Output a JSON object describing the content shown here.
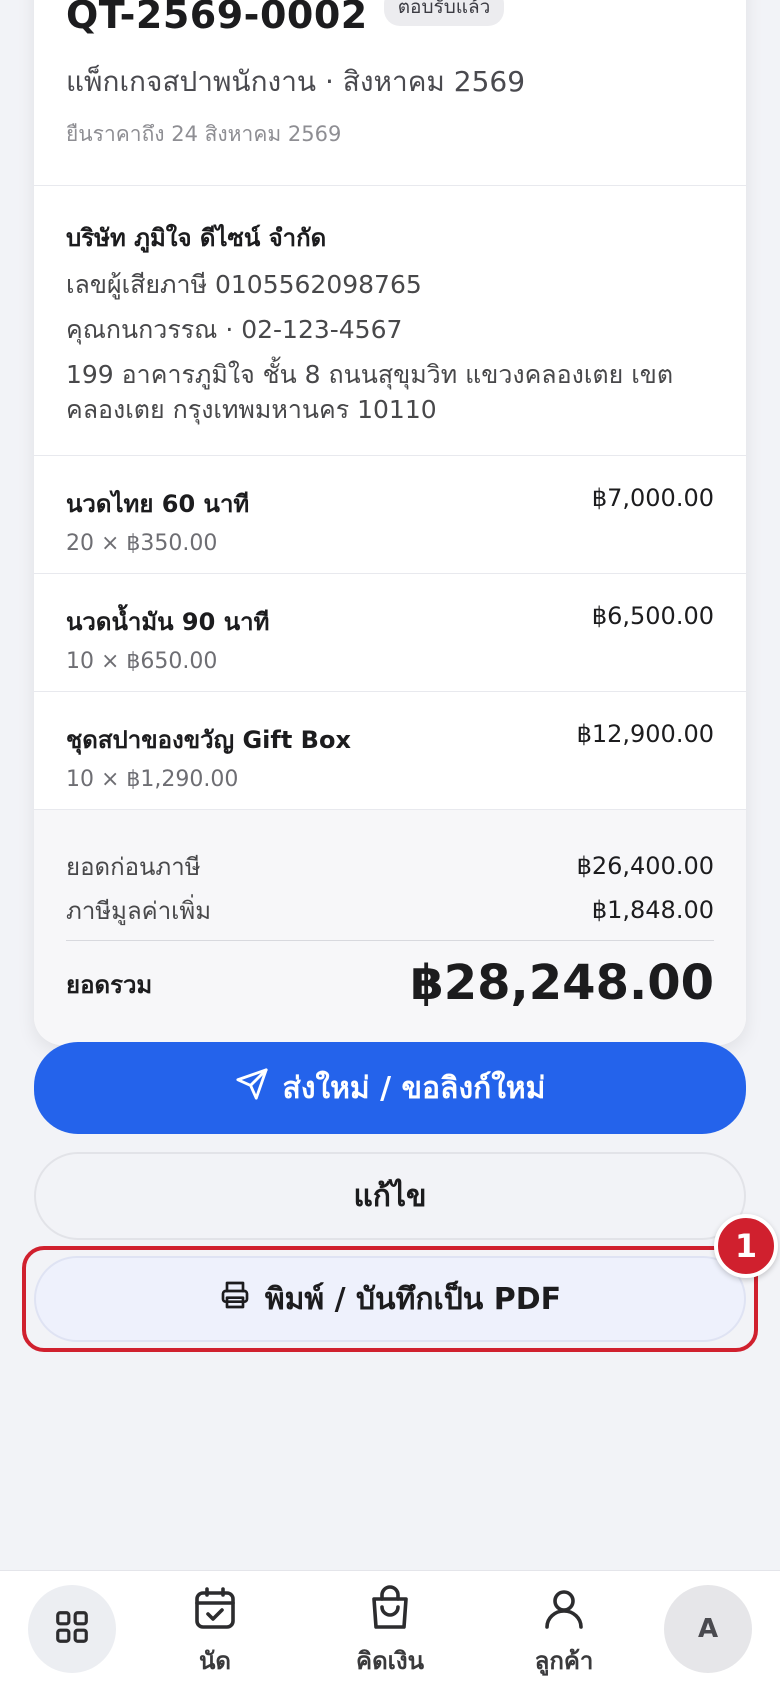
{
  "quote": {
    "number": "QT-2569-0002",
    "status": "ตอบรับแล้ว",
    "title": "แพ็กเกจสปาพนักงาน · สิงหาคม 2569",
    "valid_until": "ยืนราคาถึง 24 สิงหาคม 2569"
  },
  "client": {
    "name": "บริษัท ภูมิใจ ดีไซน์ จำกัด",
    "tax_id": "เลขผู้เสียภาษี 0105562098765",
    "contact": "คุณกนกวรรณ · 02-123-4567",
    "address_line1": "199 อาคารภูมิใจ ชั้น 8 ถนนสุขุมวิท แขวงคลองเตย เขต",
    "address_line2": "คลองเตย กรุงเทพมหานคร 10110"
  },
  "items": [
    {
      "name": "นวดไทย 60 นาที",
      "qty": "20 × ฿350.00",
      "amount": "฿7,000.00"
    },
    {
      "name": "นวดน้ำมัน 90 นาที",
      "qty": "10 × ฿650.00",
      "amount": "฿6,500.00"
    },
    {
      "name": "ชุดสปาของขวัญ Gift Box",
      "qty": "10 × ฿1,290.00",
      "amount": "฿12,900.00"
    }
  ],
  "totals": {
    "subtotal_label": "ยอดก่อนภาษี",
    "subtotal": "฿26,400.00",
    "vat_label": "ภาษีมูลค่าเพิ่ม",
    "vat": "฿1,848.00",
    "grand_label": "ยอดรวม",
    "grand": "฿28,248.00"
  },
  "actions": {
    "resend_label": "ส่งใหม่ / ขอลิงก์ใหม่",
    "edit_label": "แก้ไข",
    "print_label": "พิมพ์ / บันทึกเป็น PDF",
    "marker": "1"
  },
  "nav": {
    "appointments_label": "นัด",
    "billing_label": "คิดเงิน",
    "customers_label": "ลูกค้า",
    "avatar_initial": "A"
  },
  "icons": {
    "send": "send-icon",
    "print": "printer-icon",
    "home": "grid-icon",
    "appointments": "calendar-check-icon",
    "billing": "shopping-bag-icon",
    "customers": "user-icon"
  },
  "colors": {
    "primary": "#2463eb",
    "highlight": "#d0202e",
    "background": "#f2f3f7"
  }
}
